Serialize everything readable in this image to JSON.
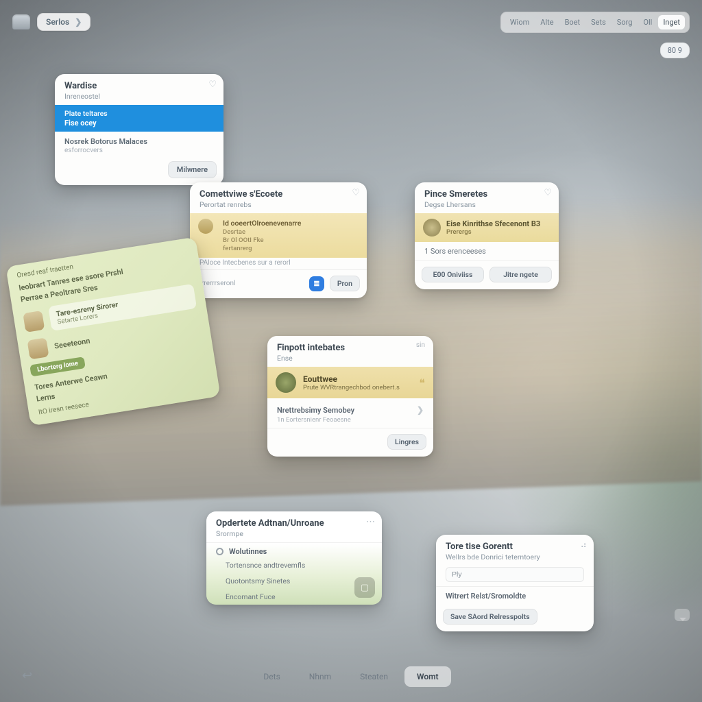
{
  "topbar": {
    "space_label": "Serlos",
    "links": [
      "Wiom",
      "Alte",
      "Boet",
      "Sets",
      "Sorg",
      "Oll",
      "Inget"
    ],
    "badge": "80 9"
  },
  "cardA": {
    "title": "Wardise",
    "subtitle": "Inreneostel",
    "blue_top": "Plate teltares",
    "blue_main": "Fise ocey",
    "line1": "Nosrek Botorus Malaces",
    "line2": "esforrocvers",
    "button": "Milwnere"
  },
  "cardB": {
    "title": "Comettviwe s'Ecoete",
    "subtitle": "Perortat renrebs",
    "lines": [
      "Id ooeertOlroenevenarre",
      "Desrtae",
      "Br Ol OOtI Fke",
      "fertanrerg"
    ],
    "note": "PAloce Intecbenes sur a rerorl",
    "foot_label": "Orrerrrseronl",
    "button": "Pron"
  },
  "cardC": {
    "title": "Pince Smeretes",
    "subtitle": "Degse Lhersans",
    "strip_t1": "Eise Kinrithse Sfecenont B3",
    "strip_t2": "Prerergs",
    "line": "1 Sors erenceeses",
    "btn_left": "E00 Oniviiss",
    "btn_right": "Jitre ngete"
  },
  "cardD": {
    "top_label": "Oresd reaf traetten",
    "l1": "Ieobrart Tanres ese asore Prshl",
    "l2": "Perrae a Peoltrare Sres",
    "block1_t": "Tare-esreny Sirorer",
    "block1_s": "Setarte Lorers",
    "row2": "Seeeteonn",
    "tag": "Lborterg lome",
    "l3": "Tores Anterwe Ceawn",
    "l4": "Lerns",
    "foot": "ItO iresn reesece"
  },
  "cardE": {
    "title": "Finpott intebates",
    "subtitle": "Ense",
    "time": "sin",
    "strip_t1": "Eouttwee",
    "strip_t2": "Prute WVRtrangechbod onebert.s",
    "line": "Nrettrebsimy Semobey",
    "hint": "1n Eortersnienr Feoaesne",
    "button": "Lingres"
  },
  "cardF": {
    "title": "Opdertete Adtnan/Unroane",
    "subtitle": "Srormpe",
    "r1": "Wolutinnes",
    "items": [
      "Tortensnce andtrevemfls",
      "Quotontsmy Sinetes",
      "Encomant Fuce"
    ]
  },
  "cardG": {
    "title": "Tore tise Gorentt",
    "subtitle": "Wellrs bde Donrici teterntoery",
    "input_value": "Ply",
    "line": "Witrert Relst/Sromoldte",
    "button": "Save SAord Relresspolts"
  },
  "tabs": [
    "Dets",
    "Nhnm",
    "Steaten",
    "Womt"
  ]
}
